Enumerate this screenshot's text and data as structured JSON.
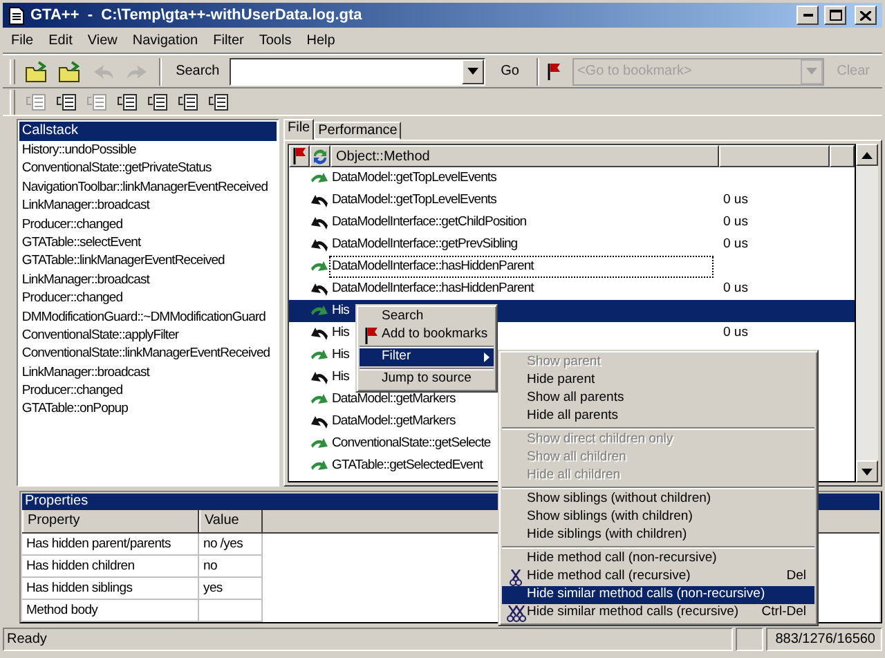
{
  "window": {
    "title": "GTA++  -  C:\\Temp\\gta++-withUserData.log.gta"
  },
  "menu": [
    {
      "label": "File"
    },
    {
      "label": "Edit"
    },
    {
      "label": "View"
    },
    {
      "label": "Navigation"
    },
    {
      "label": "Filter"
    },
    {
      "label": "Tools"
    },
    {
      "label": "Help"
    }
  ],
  "toolbar": {
    "buttons": [
      {
        "kind": "open",
        "disabled": false
      },
      {
        "kind": "open",
        "disabled": false
      },
      {
        "kind": "undo",
        "disabled": true
      },
      {
        "kind": "redo",
        "disabled": true
      }
    ],
    "search_label": "Search",
    "go": "Go",
    "bookmark_placeholder": "<Go to bookmark>",
    "clear": "Clear",
    "clear_disabled": true
  },
  "filter_toolbar": [
    {
      "disabled": true
    },
    {
      "disabled": false
    },
    {
      "disabled": true
    },
    {
      "disabled": false
    },
    {
      "disabled": false
    },
    {
      "disabled": false
    },
    {
      "disabled": false
    }
  ],
  "callstack": {
    "title": "Callstack",
    "items": [
      "History::undoPossible",
      "ConventionalState::getPrivateStatus",
      "NavigationToolbar::linkManagerEventReceived",
      "LinkManager::broadcast",
      "Producer::changed",
      "GTATable::selectEvent",
      "GTATable::linkManagerEventReceived",
      "LinkManager::broadcast",
      "Producer::changed",
      "DMModificationGuard::~DMModificationGuard",
      "ConventionalState::applyFilter",
      "ConventionalState::linkManagerEventReceived",
      "LinkManager::broadcast",
      "Producer::changed",
      "GTATable::onPopup"
    ]
  },
  "tabs": [
    {
      "label": "File",
      "selected": true
    },
    {
      "label": "Performance",
      "selected": false
    }
  ],
  "events": {
    "column": "Object::Method",
    "rows": [
      {
        "kind": "call",
        "method": "DataModel::getTopLevelEvents",
        "time": "",
        "selected": false,
        "focused": false
      },
      {
        "kind": "return",
        "method": "DataModel::getTopLevelEvents",
        "time": "0 us",
        "selected": false,
        "focused": false
      },
      {
        "kind": "return",
        "method": "DataModelInterface::getChildPosition",
        "time": "0 us",
        "selected": false,
        "focused": false
      },
      {
        "kind": "return",
        "method": "DataModelInterface::getPrevSibling",
        "time": "0 us",
        "selected": false,
        "focused": false
      },
      {
        "kind": "call",
        "method": "DataModelInterface::hasHiddenParent",
        "time": "",
        "selected": false,
        "focused": true
      },
      {
        "kind": "return",
        "method": "DataModelInterface::hasHiddenParent",
        "time": "0 us",
        "selected": false,
        "focused": false
      },
      {
        "kind": "call",
        "method": "His",
        "time": "",
        "selected": true,
        "focused": false
      },
      {
        "kind": "return",
        "method": "His",
        "time": "0 us",
        "selected": false,
        "focused": false
      },
      {
        "kind": "call",
        "method": "His",
        "time": "",
        "selected": false,
        "focused": false
      },
      {
        "kind": "return",
        "method": "His",
        "time": "",
        "selected": false,
        "focused": false
      },
      {
        "kind": "call",
        "method": "DataModel::getMarkers",
        "time": "",
        "selected": false,
        "focused": false
      },
      {
        "kind": "return",
        "method": "DataModel::getMarkers",
        "time": "",
        "selected": false,
        "focused": false
      },
      {
        "kind": "call",
        "method": "ConventionalState::getSelecte",
        "time": "",
        "selected": false,
        "focused": false
      },
      {
        "kind": "call",
        "method": "GTATable::getSelectedEvent",
        "time": "",
        "selected": false,
        "focused": false
      }
    ]
  },
  "properties": {
    "title": "Properties",
    "columns": [
      "Property",
      "Value"
    ],
    "rows": [
      [
        "Has hidden parent/parents",
        "no /yes"
      ],
      [
        "Has hidden children",
        "no"
      ],
      [
        "Has hidden siblings",
        "yes"
      ],
      [
        "Method body",
        ""
      ]
    ]
  },
  "context_menu": [
    {
      "kind": "item",
      "label": "Search",
      "selected": false
    },
    {
      "kind": "bookmark",
      "label": "Add to bookmarks",
      "selected": false
    },
    {
      "kind": "separator"
    },
    {
      "kind": "submenu",
      "label": "Filter",
      "selected": true
    },
    {
      "kind": "separator"
    },
    {
      "kind": "item",
      "label": "Jump to source",
      "selected": false
    }
  ],
  "filter_menu": [
    {
      "kind": "item",
      "label": "Show parent",
      "disabled": true,
      "selected": false
    },
    {
      "kind": "item",
      "label": "Hide parent",
      "disabled": false,
      "selected": false
    },
    {
      "kind": "item",
      "label": "Show all parents",
      "disabled": false,
      "selected": false
    },
    {
      "kind": "item",
      "label": "Hide all parents",
      "disabled": false,
      "selected": false
    },
    {
      "kind": "separator"
    },
    {
      "kind": "item",
      "label": "Show direct children only",
      "disabled": true,
      "selected": false
    },
    {
      "kind": "item",
      "label": "Show all children",
      "disabled": true,
      "selected": false
    },
    {
      "kind": "item",
      "label": "Hide all children",
      "disabled": true,
      "selected": false
    },
    {
      "kind": "separator"
    },
    {
      "kind": "item",
      "label": "Show siblings (without children)",
      "disabled": false,
      "selected": false
    },
    {
      "kind": "item",
      "label": "Show siblings (with children)",
      "disabled": false,
      "selected": false
    },
    {
      "kind": "item",
      "label": "Hide siblings (with children)",
      "disabled": false,
      "selected": false
    },
    {
      "kind": "separator"
    },
    {
      "kind": "item",
      "label": "Hide method call (non-recursive)",
      "disabled": false,
      "selected": false
    },
    {
      "kind": "cut",
      "label": "Hide method call (recursive)",
      "shortcut": "Del",
      "disabled": false,
      "selected": false
    },
    {
      "kind": "item",
      "label": "Hide similar method calls (non-recursive)",
      "disabled": false,
      "selected": true
    },
    {
      "kind": "cut-all",
      "label": "Hide similar method calls (recursive)",
      "shortcut": "Ctrl-Del",
      "disabled": false,
      "selected": false
    }
  ],
  "status_bar": {
    "text": "Ready",
    "counts": "883/1276/16560"
  }
}
